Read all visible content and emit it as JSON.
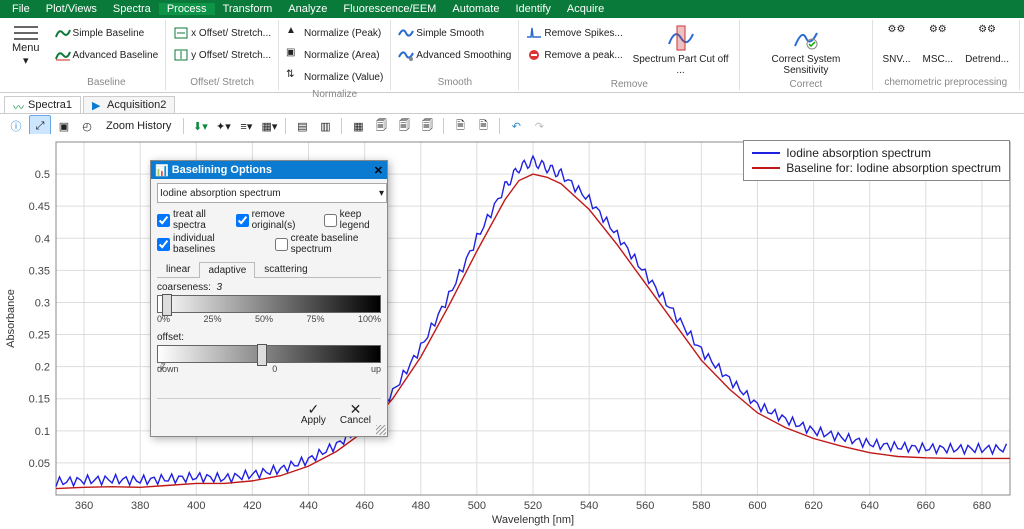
{
  "menu": {
    "items": [
      "File",
      "Plot/Views",
      "Spectra",
      "Process",
      "Transform",
      "Analyze",
      "Fluorescence/EEM",
      "Automate",
      "Identify",
      "Acquire"
    ],
    "active": 3
  },
  "ribbon": {
    "menuLabel": "Menu",
    "groups": {
      "baseline": {
        "label": "Baseline",
        "simple": "Simple Baseline",
        "advanced": "Advanced Baseline"
      },
      "offset": {
        "label": "Offset/ Stretch",
        "x": "x Offset/ Stretch...",
        "y": "y Offset/ Stretch..."
      },
      "normalize": {
        "label": "Normalize",
        "peak": "Normalize (Peak)",
        "area": "Normalize (Area)",
        "value": "Normalize (Value)"
      },
      "smooth": {
        "label": "Smooth",
        "simple": "Simple Smooth",
        "advanced": "Advanced Smoothing"
      },
      "remove": {
        "label": "Remove",
        "spikes": "Remove Spikes...",
        "peak": "Remove a peak...",
        "partcut": "Spectrum Part Cut off ..."
      },
      "correct": {
        "label": "Correct",
        "sens": "Correct System Sensitivity"
      },
      "chemo": {
        "label": "chemometric preprocessing",
        "snv": "SNV...",
        "msc": "MSC...",
        "detrend": "Detrend..."
      }
    }
  },
  "tabs": {
    "items": [
      {
        "label": "Spectra1",
        "icon": "spectra"
      },
      {
        "label": "Acquisition2",
        "icon": "play"
      }
    ],
    "active": 0
  },
  "toolbar": {
    "zoomHistory": "Zoom History"
  },
  "legend": {
    "entries": [
      {
        "label": "Iodine absorption spectrum",
        "color": "#2020e0"
      },
      {
        "label": "Baseline for: Iodine absorption spectrum",
        "color": "#c01818"
      }
    ]
  },
  "dialog": {
    "title": "Baselining Options",
    "spectrum": "Iodine absorption spectrum",
    "checks": {
      "treatAll": "treat all spectra",
      "removeOrig": "remove original(s)",
      "keepLegend": "keep legend",
      "indiv": "individual baselines",
      "createBaseline": "create baseline spectrum"
    },
    "checksState": {
      "treatAll": true,
      "removeOrig": true,
      "keepLegend": false,
      "indiv": true,
      "createBaseline": false
    },
    "tabs": [
      "linear",
      "adaptive",
      "scattering"
    ],
    "activeTab": 1,
    "coarseness": {
      "label": "coarseness:",
      "value": "3",
      "ticks": [
        "0%",
        "25%",
        "50%",
        "75%",
        "100%"
      ],
      "thumbPct": 4
    },
    "offset": {
      "label": "offset:",
      "value": "-7",
      "ticks": [
        "down",
        "0",
        "up"
      ],
      "thumbPct": 47
    },
    "apply": "Apply",
    "cancel": "Cancel"
  },
  "axes": {
    "xlabel": "Wavelength [nm]",
    "ylabel": "Absorbance"
  },
  "chart_data": {
    "type": "line",
    "xlabel": "Wavelength [nm]",
    "ylabel": "Absorbance",
    "xlim": [
      350,
      690
    ],
    "ylim": [
      0,
      0.55
    ],
    "xticks": [
      360,
      380,
      400,
      420,
      440,
      460,
      480,
      500,
      520,
      540,
      560,
      580,
      600,
      620,
      640,
      660,
      680
    ],
    "yticks": [
      0.05,
      0.1,
      0.15,
      0.2,
      0.25,
      0.3,
      0.35,
      0.4,
      0.45,
      0.5
    ],
    "series": [
      {
        "name": "Iodine absorption spectrum",
        "color": "#2020e0",
        "x": [
          350,
          360,
          370,
          380,
          390,
          400,
          410,
          420,
          430,
          440,
          450,
          460,
          470,
          480,
          490,
          500,
          510,
          515,
          520,
          525,
          530,
          540,
          550,
          560,
          570,
          580,
          590,
          600,
          610,
          620,
          630,
          640,
          650,
          660,
          670,
          680,
          690
        ],
        "y": [
          0.02,
          0.023,
          0.024,
          0.023,
          0.025,
          0.028,
          0.026,
          0.032,
          0.04,
          0.055,
          0.078,
          0.11,
          0.16,
          0.23,
          0.31,
          0.4,
          0.48,
          0.51,
          0.52,
          0.51,
          0.5,
          0.46,
          0.405,
          0.345,
          0.285,
          0.225,
          0.18,
          0.14,
          0.118,
          0.1,
          0.09,
          0.08,
          0.075,
          0.073,
          0.072,
          0.072,
          0.072
        ],
        "ripple": 0.016
      },
      {
        "name": "Baseline for: Iodine absorption spectrum",
        "color": "#c01818",
        "x": [
          350,
          360,
          370,
          380,
          390,
          400,
          410,
          420,
          430,
          440,
          450,
          460,
          470,
          480,
          490,
          500,
          510,
          515,
          520,
          525,
          530,
          540,
          550,
          560,
          570,
          580,
          590,
          600,
          610,
          620,
          630,
          640,
          650,
          660,
          670,
          680,
          690
        ],
        "y": [
          0.01,
          0.012,
          0.013,
          0.012,
          0.015,
          0.018,
          0.018,
          0.022,
          0.03,
          0.045,
          0.068,
          0.1,
          0.15,
          0.215,
          0.295,
          0.38,
          0.46,
          0.49,
          0.5,
          0.495,
          0.485,
          0.445,
          0.39,
          0.33,
          0.27,
          0.21,
          0.165,
          0.128,
          0.105,
          0.088,
          0.076,
          0.066,
          0.06,
          0.058,
          0.057,
          0.057,
          0.057
        ],
        "ripple": 0
      }
    ]
  }
}
